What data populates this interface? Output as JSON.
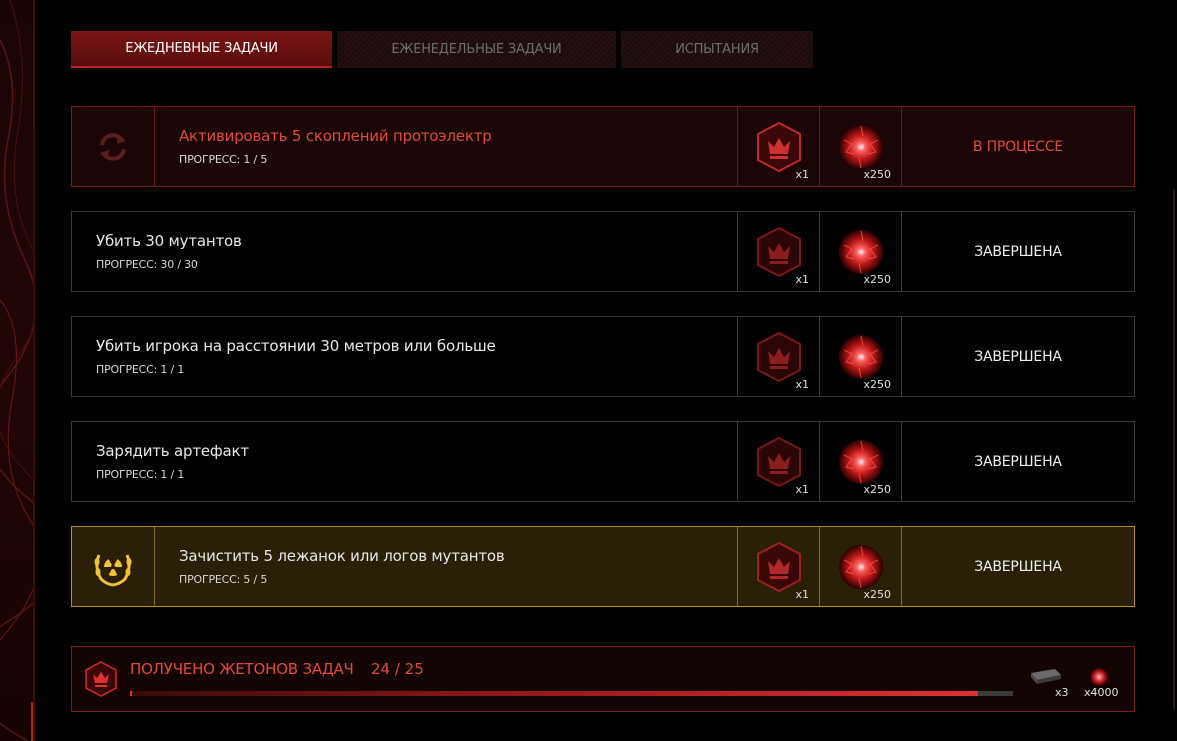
{
  "tabs": [
    {
      "label": "ЕЖЕДНЕВНЫЕ ЗАДАЧИ",
      "active": true
    },
    {
      "label": "ЕЖЕНЕДЕЛЬНЫЕ ЗАДАЧИ",
      "active": false
    },
    {
      "label": "ИСПЫТАНИЯ",
      "active": false
    }
  ],
  "tasks": [
    {
      "title": "Активировать 5 скоплений протоэлектр",
      "progress": "ПРОГРЕСС: 1 / 5",
      "reward_token_qty": "x1",
      "reward_orb_qty": "x250",
      "status": "В ПРОЦЕССЕ",
      "icon": "refresh-icon"
    },
    {
      "title": "Убить 30 мутантов",
      "progress": "ПРОГРЕСС: 30 / 30",
      "reward_token_qty": "x1",
      "reward_orb_qty": "x250",
      "status": "ЗАВЕРШЕНА"
    },
    {
      "title": "Убить игрока на расстоянии 30 метров или больше",
      "progress": "ПРОГРЕСС: 1 / 1",
      "reward_token_qty": "x1",
      "reward_orb_qty": "x250",
      "status": "ЗАВЕРШЕНА"
    },
    {
      "title": "Зарядить артефакт",
      "progress": "ПРОГРЕСС: 1 / 1",
      "reward_token_qty": "x1",
      "reward_orb_qty": "x250",
      "status": "ЗАВЕРШЕНА"
    },
    {
      "title": "Зачистить 5 лежанок или логов мутантов",
      "progress": "ПРОГРЕСС: 5 / 5",
      "reward_token_qty": "x1",
      "reward_orb_qty": "x250",
      "status": "ЗАВЕРШЕНА",
      "icon": "radiation-laurel-icon"
    }
  ],
  "tokens": {
    "label": "ПОЛУЧЕНО ЖЕТОНОВ ЗАДАЧ",
    "count": "24 / 25",
    "progress_fraction": 0.96,
    "reward_case_qty": "x3",
    "reward_orb_qty": "x4000"
  },
  "colors": {
    "accent_red": "#e04a3a",
    "gold": "#b48a2a"
  }
}
